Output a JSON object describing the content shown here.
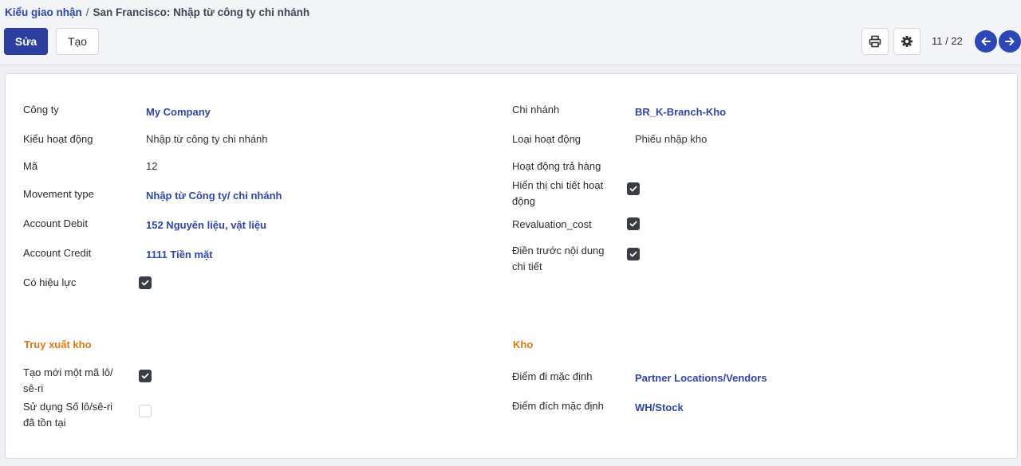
{
  "breadcrumb": {
    "parent": "Kiểu giao nhận",
    "separator": "/",
    "current": "San Francisco: Nhập từ công ty chi nhánh"
  },
  "toolbar": {
    "edit_label": "Sửa",
    "create_label": "Tạo",
    "print_icon": "printer-icon",
    "settings_icon": "gear-icon"
  },
  "pager": {
    "text": "11 / 22",
    "prev_icon": "arrow-left-icon",
    "next_icon": "arrow-right-icon"
  },
  "form": {
    "left": {
      "company": {
        "label": "Công ty",
        "value": "My Company"
      },
      "operation_kind": {
        "label": "Kiểu hoạt động",
        "value": "Nhập từ công ty chi nhánh"
      },
      "code": {
        "label": "Mã",
        "value": "12"
      },
      "movement_type": {
        "label": "Movement type",
        "value": "Nhập từ Công ty/ chi nhánh"
      },
      "account_debit": {
        "label": "Account Debit",
        "value": "152 Nguyên liệu, vật liệu"
      },
      "account_credit": {
        "label": "Account Credit",
        "value": "1111 Tiền mặt"
      },
      "active": {
        "label": "Có hiệu lực",
        "checked": true
      }
    },
    "right": {
      "branch": {
        "label": "Chi nhánh",
        "value": "BR_K-Branch-Kho"
      },
      "operation_type": {
        "label": "Loại hoạt động",
        "value": "Phiếu nhập kho"
      },
      "return_operation": {
        "label": "Hoạt động trả hàng",
        "value": ""
      },
      "show_detailed": {
        "label_line1": "Hiển thị chi tiết hoạt",
        "label_line2": "động",
        "checked": true
      },
      "revaluation_cost": {
        "label": "Revaluation_cost",
        "checked": true
      },
      "prefill_detail": {
        "label_line1": "Điền trước nội dung",
        "label_line2": "chi tiết",
        "checked": true
      }
    }
  },
  "traceability": {
    "title": "Truy xuất kho",
    "create_lots": {
      "label_line1": "Tạo mới một mã lô/",
      "label_line2": "sê-ri",
      "checked": true
    },
    "use_existing_lots": {
      "label_line1": "Sử dụng Số lô/sê-ri",
      "label_line2": "đã tồn tại",
      "checked": false
    }
  },
  "warehouse": {
    "title": "Kho",
    "default_source": {
      "label": "Điểm đi mặc định",
      "value": "Partner Locations/Vendors"
    },
    "default_destination": {
      "label": "Điểm đích mặc định",
      "value": "WH/Stock"
    }
  },
  "colors": {
    "primary": "#2c3e9e",
    "link": "#2f46a8",
    "section": "#e07a10",
    "checkbox_on": "#3a3d44"
  }
}
